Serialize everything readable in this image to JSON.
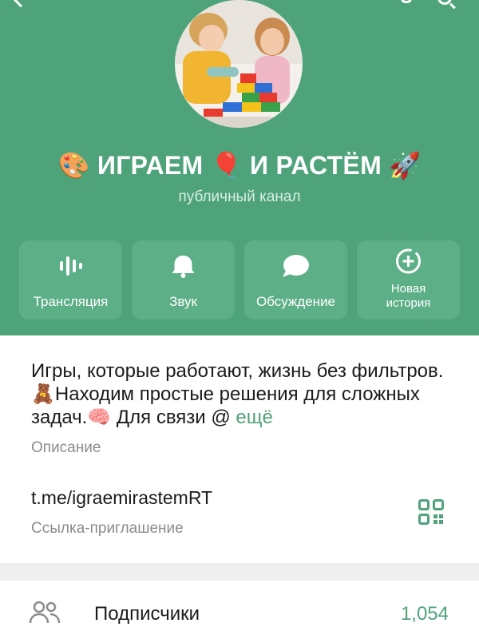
{
  "channel": {
    "title": "🎨 ИГРАЕМ 🎈 И РАСТЁМ 🚀",
    "type_label": "публичный канал"
  },
  "actions": [
    {
      "label": "Трансляция",
      "icon": "live-stream-icon"
    },
    {
      "label": "Звук",
      "icon": "bell-icon"
    },
    {
      "label": "Обсуждение",
      "icon": "chat-bubble-icon"
    },
    {
      "label_line1": "Новая",
      "label_line2": "история",
      "icon": "add-story-icon"
    }
  ],
  "about": {
    "description": "Игры, которые работают, жизнь без фильтров. 🧸Находим простые решения для сложных задач.🧠  Для связи @",
    "more_label": "ещё",
    "description_label": "Описание",
    "invite_link": "t.me/igraemirastemRT",
    "invite_link_label": "Ссылка-приглашение"
  },
  "subscribers": {
    "label": "Подписчики",
    "count": "1,054"
  },
  "colors": {
    "header_bg": "#4fa37a",
    "accent": "#4fa37a",
    "button_bg": "#5caf87"
  }
}
